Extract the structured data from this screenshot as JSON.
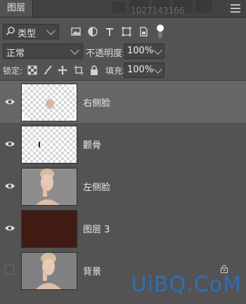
{
  "panel": {
    "title": "图层",
    "watermark_number": "1027143166"
  },
  "filter": {
    "kind_label": "类型"
  },
  "blend": {
    "mode": "正常",
    "opacity_label": "不透明度:",
    "opacity_value": "100%"
  },
  "lock": {
    "label": "锁定:",
    "fill_label": "填充:",
    "fill_value": "100%"
  },
  "layers": [
    {
      "name": "右侧脸",
      "visible": true,
      "selected": true
    },
    {
      "name": "颧骨",
      "visible": true,
      "selected": false
    },
    {
      "name": "左侧脸",
      "visible": true,
      "selected": false
    },
    {
      "name": "图层 3",
      "visible": true,
      "selected": false
    },
    {
      "name": "背景",
      "visible": false,
      "selected": false,
      "locked": true
    }
  ],
  "brand": {
    "text1": "UiBQ",
    "text2": ".CoM"
  },
  "colors": {
    "bg": "#535353",
    "selected": "#666666",
    "layer3_fill": "#3f1b14",
    "brand_blue": "#2f6fb7"
  }
}
